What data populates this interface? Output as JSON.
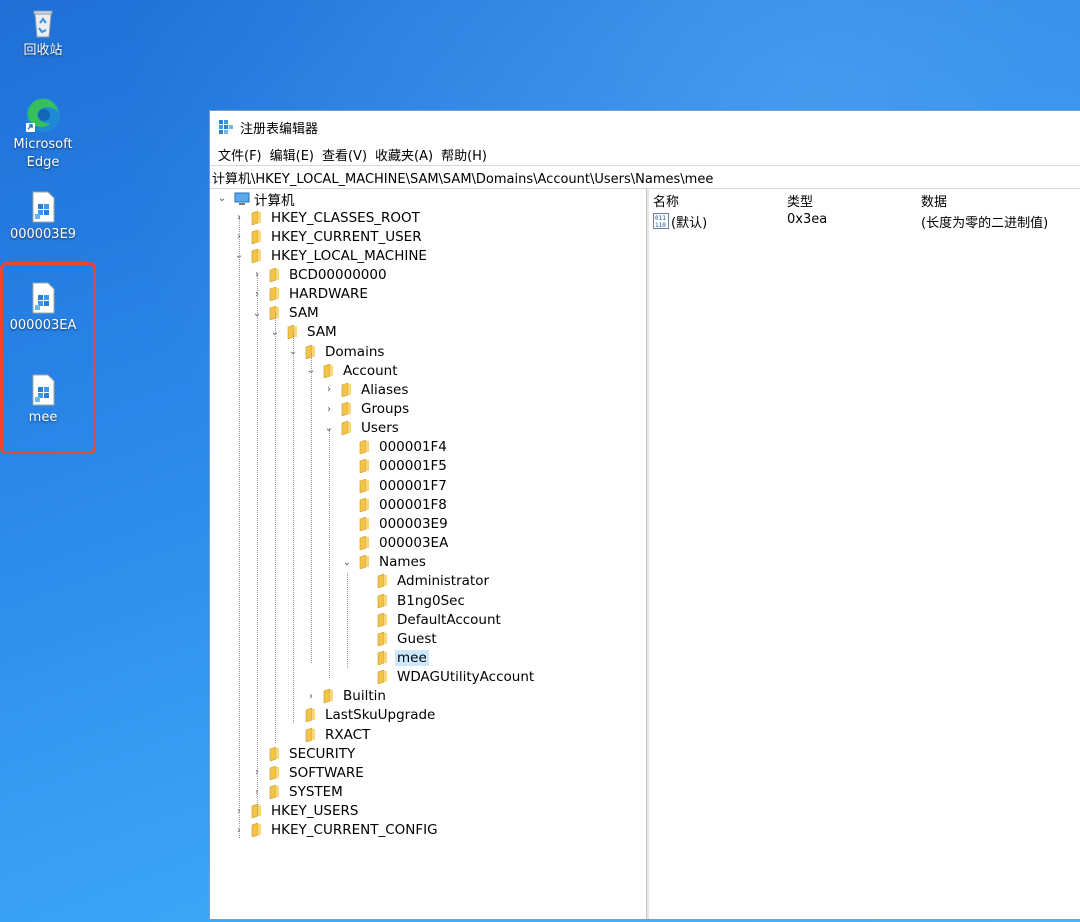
{
  "desktop": {
    "icons": [
      {
        "label": "回收站",
        "icon": "recycle-bin-icon"
      },
      {
        "label": "Microsoft Edge",
        "icon": "edge-icon"
      },
      {
        "label": "000003E9",
        "icon": "registry-file-icon"
      },
      {
        "label": "000003EA",
        "icon": "registry-file-icon"
      },
      {
        "label": "mee",
        "icon": "registry-file-icon"
      }
    ],
    "highlight_color": "#e8463c"
  },
  "window": {
    "title": "注册表编辑器",
    "menu": [
      "文件(F)",
      "编辑(E)",
      "查看(V)",
      "收藏夹(A)",
      "帮助(H)"
    ],
    "address": "计算机\\HKEY_LOCAL_MACHINE\\SAM\\SAM\\Domains\\Account\\Users\\Names\\mee"
  },
  "tree": {
    "root": "计算机",
    "nodes": [
      {
        "label": "HKEY_CLASSES_ROOT",
        "exp": "›"
      },
      {
        "label": "HKEY_CURRENT_USER",
        "exp": "›"
      },
      {
        "label": "HKEY_LOCAL_MACHINE",
        "exp": "⌄"
      },
      {
        "label": "BCD00000000",
        "exp": "›"
      },
      {
        "label": "HARDWARE",
        "exp": "›"
      },
      {
        "label": "SAM",
        "exp": "⌄"
      },
      {
        "label": "SAM",
        "exp": "⌄"
      },
      {
        "label": "Domains",
        "exp": "⌄"
      },
      {
        "label": "Account",
        "exp": "⌄"
      },
      {
        "label": "Aliases",
        "exp": "›"
      },
      {
        "label": "Groups",
        "exp": "›"
      },
      {
        "label": "Users",
        "exp": "⌄"
      },
      {
        "label": "000001F4",
        "exp": ""
      },
      {
        "label": "000001F5",
        "exp": ""
      },
      {
        "label": "000001F7",
        "exp": ""
      },
      {
        "label": "000001F8",
        "exp": ""
      },
      {
        "label": "000003E9",
        "exp": ""
      },
      {
        "label": "000003EA",
        "exp": ""
      },
      {
        "label": "Names",
        "exp": "⌄"
      },
      {
        "label": "Administrator",
        "exp": ""
      },
      {
        "label": "B1ng0Sec",
        "exp": ""
      },
      {
        "label": "DefaultAccount",
        "exp": ""
      },
      {
        "label": "Guest",
        "exp": ""
      },
      {
        "label": "mee",
        "exp": "",
        "selected": true
      },
      {
        "label": "WDAGUtilityAccount",
        "exp": ""
      },
      {
        "label": "Builtin",
        "exp": "›"
      },
      {
        "label": "LastSkuUpgrade",
        "exp": ""
      },
      {
        "label": "RXACT",
        "exp": ""
      },
      {
        "label": "SECURITY",
        "exp": ""
      },
      {
        "label": "SOFTWARE",
        "exp": "›"
      },
      {
        "label": "SYSTEM",
        "exp": "›"
      },
      {
        "label": "HKEY_USERS",
        "exp": "›"
      },
      {
        "label": "HKEY_CURRENT_CONFIG",
        "exp": "›"
      }
    ]
  },
  "values_pane": {
    "columns": {
      "name": "名称",
      "type": "类型",
      "data": "数据"
    },
    "rows": [
      {
        "name": "(默认)",
        "type": "0x3ea",
        "data": "(长度为零的二进制值)",
        "icon": "binary-value-icon"
      }
    ]
  },
  "colors": {
    "selection": "#cce8ff",
    "folder": "#f3c44a"
  }
}
